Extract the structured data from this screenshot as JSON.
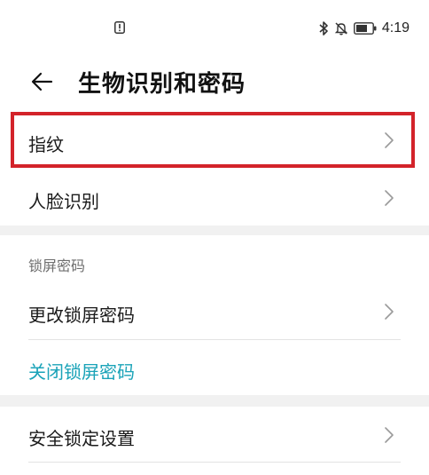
{
  "status_bar": {
    "time": "4:19",
    "icons": [
      "alert-icon",
      "bluetooth-icon",
      "mute-bell-icon",
      "battery-icon"
    ]
  },
  "header": {
    "back_icon": "arrow-left-icon",
    "title": "生物识别和密码"
  },
  "biometrics": {
    "items": [
      {
        "label": "指纹",
        "highlighted": true,
        "icon": "chevron-right-icon"
      },
      {
        "label": "人脸识别",
        "icon": "chevron-right-icon"
      }
    ]
  },
  "lock_screen": {
    "section_label": "锁屏密码",
    "change_password": "更改锁屏密码",
    "close_password": "关闭锁屏密码",
    "close_password_color": "#1aa3b8"
  },
  "security": {
    "lock_settings": "安全锁定设置"
  },
  "colors": {
    "highlight_border": "#d3232a",
    "section_background": "#f1f1f1"
  }
}
